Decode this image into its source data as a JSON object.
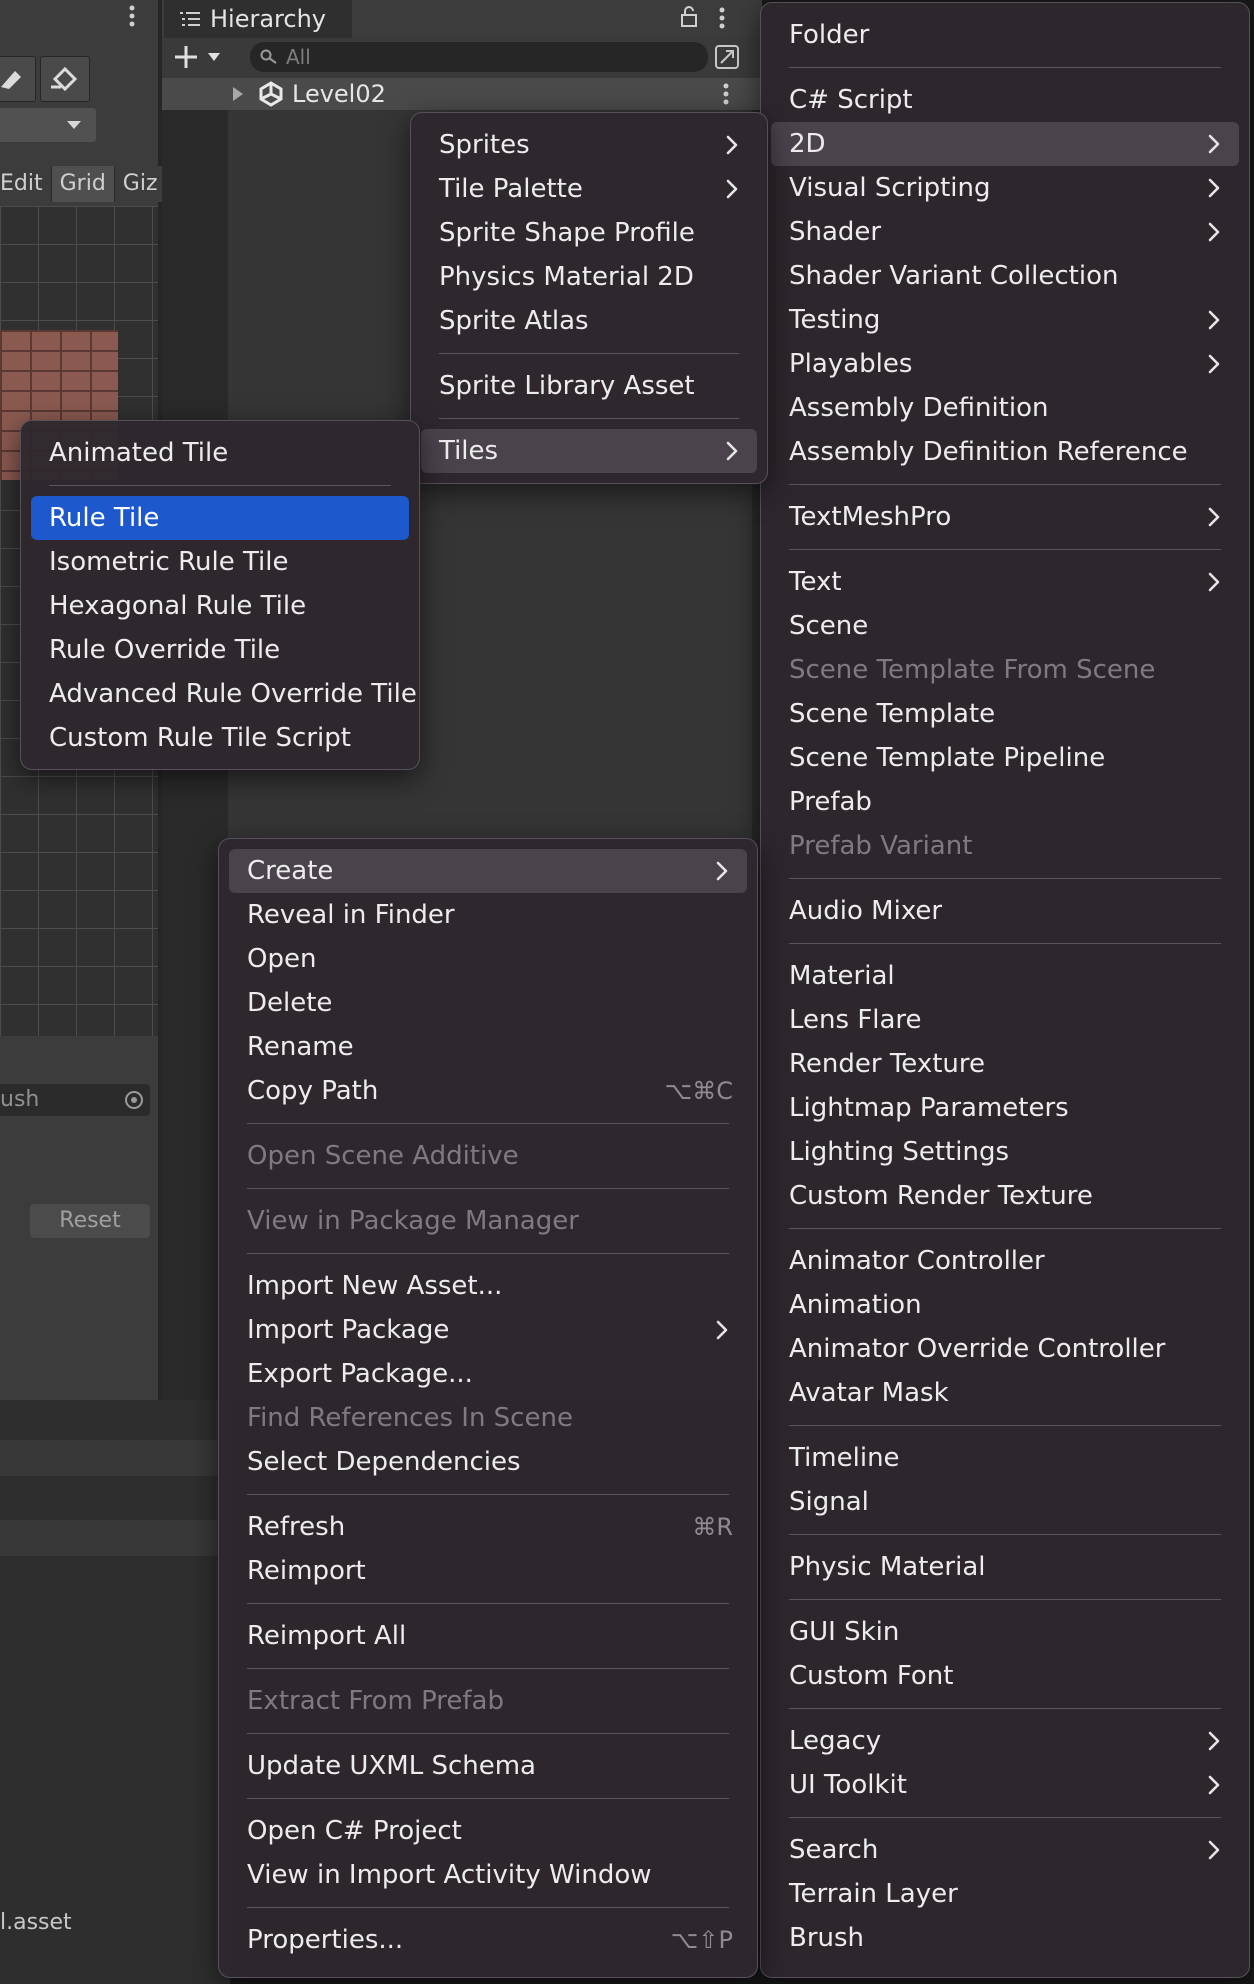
{
  "editor": {
    "tabs": [
      "Edit",
      "Grid",
      "Giz"
    ],
    "brush_field": "ush",
    "reset_label": "Reset",
    "asset_label": "l.asset"
  },
  "hierarchy": {
    "title": "Hierarchy",
    "search_placeholder": "All",
    "scene_name": "Level02"
  },
  "context_menu": [
    {
      "label": "Create",
      "submenu": true,
      "highlighted": true
    },
    {
      "label": "Reveal in Finder"
    },
    {
      "label": "Open"
    },
    {
      "label": "Delete"
    },
    {
      "label": "Rename"
    },
    {
      "label": "Copy Path",
      "shortcut": "⌥⌘C"
    },
    {
      "separator": true
    },
    {
      "label": "Open Scene Additive",
      "disabled": true
    },
    {
      "separator": true
    },
    {
      "label": "View in Package Manager",
      "disabled": true
    },
    {
      "separator": true
    },
    {
      "label": "Import New Asset..."
    },
    {
      "label": "Import Package",
      "submenu": true
    },
    {
      "label": "Export Package..."
    },
    {
      "label": "Find References In Scene",
      "disabled": true
    },
    {
      "label": "Select Dependencies"
    },
    {
      "separator": true
    },
    {
      "label": "Refresh",
      "shortcut": "⌘R"
    },
    {
      "label": "Reimport"
    },
    {
      "separator": true
    },
    {
      "label": "Reimport All"
    },
    {
      "separator": true
    },
    {
      "label": "Extract From Prefab",
      "disabled": true
    },
    {
      "separator": true
    },
    {
      "label": "Update UXML Schema"
    },
    {
      "separator": true
    },
    {
      "label": "Open C# Project"
    },
    {
      "label": "View in Import Activity Window"
    },
    {
      "separator": true
    },
    {
      "label": "Properties...",
      "shortcut": "⌥⇧P"
    }
  ],
  "create_menu": [
    {
      "label": "Folder"
    },
    {
      "separator": true
    },
    {
      "label": "C# Script"
    },
    {
      "label": "2D",
      "submenu": true,
      "highlighted": true
    },
    {
      "label": "Visual Scripting",
      "submenu": true
    },
    {
      "label": "Shader",
      "submenu": true
    },
    {
      "label": "Shader Variant Collection"
    },
    {
      "label": "Testing",
      "submenu": true
    },
    {
      "label": "Playables",
      "submenu": true
    },
    {
      "label": "Assembly Definition"
    },
    {
      "label": "Assembly Definition Reference"
    },
    {
      "separator": true
    },
    {
      "label": "TextMeshPro",
      "submenu": true
    },
    {
      "separator": true
    },
    {
      "label": "Text",
      "submenu": true
    },
    {
      "label": "Scene"
    },
    {
      "label": "Scene Template From Scene",
      "disabled": true
    },
    {
      "label": "Scene Template"
    },
    {
      "label": "Scene Template Pipeline"
    },
    {
      "label": "Prefab"
    },
    {
      "label": "Prefab Variant",
      "disabled": true
    },
    {
      "separator": true
    },
    {
      "label": "Audio Mixer"
    },
    {
      "separator": true
    },
    {
      "label": "Material"
    },
    {
      "label": "Lens Flare"
    },
    {
      "label": "Render Texture"
    },
    {
      "label": "Lightmap Parameters"
    },
    {
      "label": "Lighting Settings"
    },
    {
      "label": "Custom Render Texture"
    },
    {
      "separator": true
    },
    {
      "label": "Animator Controller"
    },
    {
      "label": "Animation"
    },
    {
      "label": "Animator Override Controller"
    },
    {
      "label": "Avatar Mask"
    },
    {
      "separator": true
    },
    {
      "label": "Timeline"
    },
    {
      "label": "Signal"
    },
    {
      "separator": true
    },
    {
      "label": "Physic Material"
    },
    {
      "separator": true
    },
    {
      "label": "GUI Skin"
    },
    {
      "label": "Custom Font"
    },
    {
      "separator": true
    },
    {
      "label": "Legacy",
      "submenu": true
    },
    {
      "label": "UI Toolkit",
      "submenu": true
    },
    {
      "separator": true
    },
    {
      "label": "Search",
      "submenu": true
    },
    {
      "label": "Terrain Layer"
    },
    {
      "label": "Brush"
    }
  ],
  "twod_menu": [
    {
      "label": "Sprites",
      "submenu": true
    },
    {
      "label": "Tile Palette",
      "submenu": true
    },
    {
      "label": "Sprite Shape Profile"
    },
    {
      "label": "Physics Material 2D"
    },
    {
      "label": "Sprite Atlas"
    },
    {
      "separator": true
    },
    {
      "label": "Sprite Library Asset"
    },
    {
      "separator": true
    },
    {
      "label": "Tiles",
      "submenu": true,
      "highlighted": true
    }
  ],
  "tiles_menu": [
    {
      "label": "Animated Tile"
    },
    {
      "separator": true
    },
    {
      "label": "Rule Tile",
      "selected": true
    },
    {
      "label": "Isometric Rule Tile"
    },
    {
      "label": "Hexagonal Rule Tile"
    },
    {
      "label": "Rule Override Tile"
    },
    {
      "label": "Advanced Rule Override Tile"
    },
    {
      "label": "Custom Rule Tile Script"
    }
  ]
}
